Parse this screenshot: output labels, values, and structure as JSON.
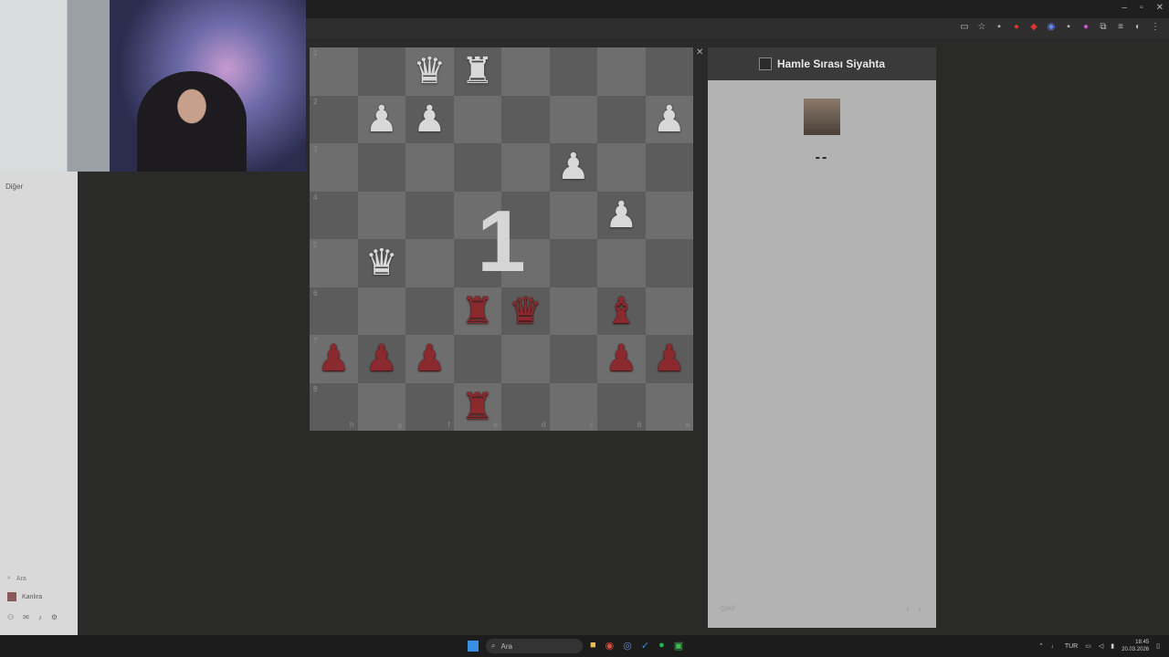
{
  "window": {
    "min": "–",
    "max": "▫",
    "close": "✕"
  },
  "toolbar": {
    "icons": [
      "cast-icon",
      "star-icon",
      "ext-icon",
      "ext-icon",
      "ext-icon",
      "ext-icon",
      "ext-icon",
      "ext-icon",
      "puzzle-icon",
      "menu-icon",
      "profile-icon",
      "more-icon"
    ]
  },
  "sidebar": {
    "section_label": "Diğer",
    "search_label": "Ara",
    "user_name": "Kanlıra"
  },
  "board": {
    "countdown": "1",
    "rank_labels": [
      "1",
      "2",
      "3",
      "4",
      "5",
      "6",
      "7",
      "8"
    ],
    "file_labels": [
      "h",
      "g",
      "f",
      "e",
      "d",
      "c",
      "b",
      "a"
    ],
    "rows": [
      [
        "",
        "",
        "♛",
        "♜",
        "",
        "",
        "",
        ""
      ],
      [
        "",
        "♟",
        "♟",
        "",
        "",
        "",
        "",
        "♟"
      ],
      [
        "",
        "",
        "",
        "",
        "",
        "♟",
        "",
        ""
      ],
      [
        "",
        "",
        "",
        "",
        "",
        "",
        "♟",
        ""
      ],
      [
        "",
        "♛",
        "",
        "",
        "",
        "",
        "",
        ""
      ],
      [
        "",
        "",
        "",
        "♜",
        "♛",
        "",
        "♝",
        ""
      ],
      [
        "♟",
        "♟",
        "♟",
        "",
        "",
        "",
        "♟",
        "♟"
      ],
      [
        "",
        "",
        "",
        "♜",
        "",
        "",
        "",
        ""
      ]
    ],
    "colors": [
      [
        "",
        "",
        "w",
        "w",
        "",
        "",
        "",
        ""
      ],
      [
        "",
        "w",
        "w",
        "",
        "",
        "",
        "",
        "w"
      ],
      [
        "",
        "",
        "",
        "",
        "",
        "w",
        "",
        ""
      ],
      [
        "",
        "",
        "",
        "",
        "",
        "",
        "w",
        ""
      ],
      [
        "",
        "w",
        "",
        "",
        "",
        "",
        "",
        ""
      ],
      [
        "",
        "",
        "",
        "b",
        "b",
        "",
        "b",
        ""
      ],
      [
        "b",
        "b",
        "b",
        "",
        "",
        "",
        "b",
        "b"
      ],
      [
        "",
        "",
        "",
        "b",
        "",
        "",
        "",
        ""
      ]
    ]
  },
  "panel": {
    "title": "Hamle Sırası Siyahta",
    "score": "--",
    "resign_label": "Çekil",
    "prev": "‹",
    "next": "›"
  },
  "taskbar": {
    "search_placeholder": "Ara",
    "lang": "TUR",
    "time": "18:45",
    "date": "20.03.2026"
  }
}
